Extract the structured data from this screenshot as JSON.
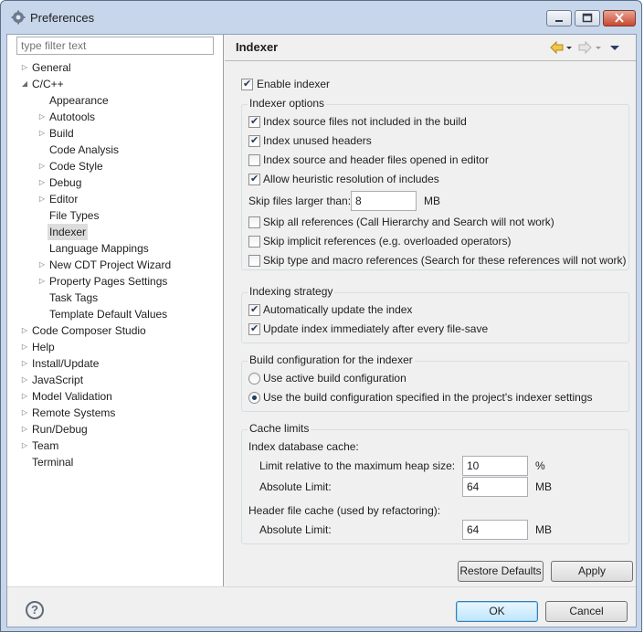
{
  "window": {
    "title": "Preferences"
  },
  "filter": {
    "placeholder": "type filter text"
  },
  "tree": [
    {
      "label": "General",
      "level": 0,
      "arrow": "collapsed"
    },
    {
      "label": "C/C++",
      "level": 0,
      "arrow": "expanded"
    },
    {
      "label": "Appearance",
      "level": 1,
      "arrow": "none"
    },
    {
      "label": "Autotools",
      "level": 1,
      "arrow": "collapsed"
    },
    {
      "label": "Build",
      "level": 1,
      "arrow": "collapsed"
    },
    {
      "label": "Code Analysis",
      "level": 1,
      "arrow": "none"
    },
    {
      "label": "Code Style",
      "level": 1,
      "arrow": "collapsed"
    },
    {
      "label": "Debug",
      "level": 1,
      "arrow": "collapsed"
    },
    {
      "label": "Editor",
      "level": 1,
      "arrow": "collapsed"
    },
    {
      "label": "File Types",
      "level": 1,
      "arrow": "none"
    },
    {
      "label": "Indexer",
      "level": 1,
      "arrow": "none",
      "selected": true
    },
    {
      "label": "Language Mappings",
      "level": 1,
      "arrow": "none"
    },
    {
      "label": "New CDT Project Wizard",
      "level": 1,
      "arrow": "collapsed"
    },
    {
      "label": "Property Pages Settings",
      "level": 1,
      "arrow": "collapsed"
    },
    {
      "label": "Task Tags",
      "level": 1,
      "arrow": "none"
    },
    {
      "label": "Template Default Values",
      "level": 1,
      "arrow": "none"
    },
    {
      "label": "Code Composer Studio",
      "level": 0,
      "arrow": "collapsed"
    },
    {
      "label": "Help",
      "level": 0,
      "arrow": "collapsed"
    },
    {
      "label": "Install/Update",
      "level": 0,
      "arrow": "collapsed"
    },
    {
      "label": "JavaScript",
      "level": 0,
      "arrow": "collapsed"
    },
    {
      "label": "Model Validation",
      "level": 0,
      "arrow": "collapsed"
    },
    {
      "label": "Remote Systems",
      "level": 0,
      "arrow": "collapsed"
    },
    {
      "label": "Run/Debug",
      "level": 0,
      "arrow": "collapsed"
    },
    {
      "label": "Team",
      "level": 0,
      "arrow": "collapsed"
    },
    {
      "label": "Terminal",
      "level": 0,
      "arrow": "none"
    }
  ],
  "page": {
    "title": "Indexer",
    "enable_indexer": {
      "label": "Enable indexer",
      "checked": true
    },
    "indexer_options": {
      "title": "Indexer options",
      "items": [
        {
          "label": "Index source files not included in the build",
          "checked": true
        },
        {
          "label": "Index unused headers",
          "checked": true
        },
        {
          "label": "Index source and header files opened in editor",
          "checked": false
        },
        {
          "label": "Allow heuristic resolution of includes",
          "checked": true
        }
      ],
      "skip_files": {
        "label": "Skip files larger than:",
        "value": "8",
        "unit": "MB"
      },
      "skip_items": [
        {
          "label": "Skip all references (Call Hierarchy and Search will not work)",
          "checked": false
        },
        {
          "label": "Skip implicit references (e.g. overloaded operators)",
          "checked": false
        },
        {
          "label": "Skip type and macro references (Search for these references will not work)",
          "checked": false
        }
      ]
    },
    "indexing_strategy": {
      "title": "Indexing strategy",
      "items": [
        {
          "label": "Automatically update the index",
          "checked": true
        },
        {
          "label": "Update index immediately after every file-save",
          "checked": true
        }
      ]
    },
    "build_config": {
      "title": "Build configuration for the indexer",
      "options": [
        {
          "label": "Use active build configuration",
          "selected": false
        },
        {
          "label": "Use the build configuration specified in the project's indexer settings",
          "selected": true
        }
      ]
    },
    "cache_limits": {
      "title": "Cache limits",
      "db_cache_label": "Index database cache:",
      "limit_relative": {
        "label": "Limit relative to the maximum heap size:",
        "value": "10",
        "unit": "%"
      },
      "db_absolute": {
        "label": "Absolute Limit:",
        "value": "64",
        "unit": "MB"
      },
      "header_cache_label": "Header file cache (used by refactoring):",
      "header_absolute": {
        "label": "Absolute Limit:",
        "value": "64",
        "unit": "MB"
      }
    },
    "restore_defaults": "Restore Defaults",
    "apply": "Apply"
  },
  "footer": {
    "help": "?",
    "ok": "OK",
    "cancel": "Cancel"
  },
  "icons": {
    "back": "back-arrow-icon",
    "forward": "forward-arrow-icon",
    "menu": "view-menu-icon",
    "help": "help-icon"
  }
}
